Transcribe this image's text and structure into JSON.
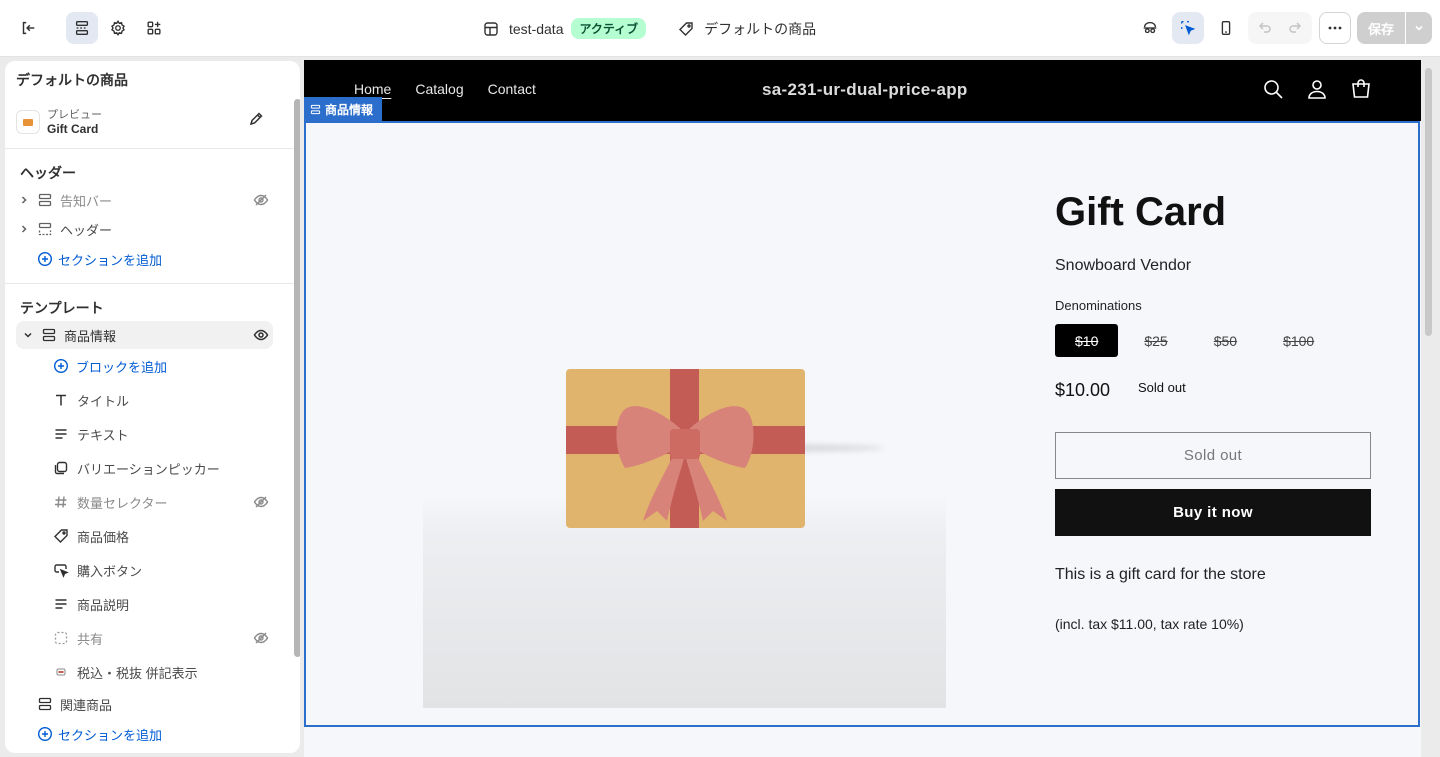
{
  "topbar": {
    "theme_name": "test-data",
    "theme_status": "アクティブ",
    "template_name": "デフォルトの商品",
    "save_label": "保存"
  },
  "sidebar": {
    "title": "デフォルトの商品",
    "preview": {
      "label": "プレビュー",
      "value": "Gift Card"
    },
    "header_group": {
      "heading": "ヘッダー",
      "items": [
        {
          "label": "告知バー",
          "hidden": true
        },
        {
          "label": "ヘッダー",
          "hidden": false
        }
      ],
      "add_section": "セクションを追加"
    },
    "template_group": {
      "heading": "テンプレート",
      "section": {
        "label": "商品情報"
      },
      "add_block": "ブロックを追加",
      "blocks": [
        {
          "label": "タイトル",
          "icon": "text-icon"
        },
        {
          "label": "テキスト",
          "icon": "align-left-icon"
        },
        {
          "label": "バリエーションピッカー",
          "icon": "variant-icon"
        },
        {
          "label": "数量セレクター",
          "icon": "hash-icon",
          "hidden": true
        },
        {
          "label": "商品価格",
          "icon": "price-tag-icon"
        },
        {
          "label": "購入ボタン",
          "icon": "cursor-button-icon"
        },
        {
          "label": "商品説明",
          "icon": "align-left-icon"
        },
        {
          "label": "共有",
          "icon": "share-frame-icon",
          "hidden": true
        },
        {
          "label": "税込・税抜 併記表示",
          "icon": "app-block-icon"
        }
      ],
      "related": "関連商品",
      "add_section": "セクションを追加"
    }
  },
  "store": {
    "nav": [
      "Home",
      "Catalog",
      "Contact"
    ],
    "name": "sa-231-ur-dual-price-app",
    "section_tag": "商品情報"
  },
  "product": {
    "title": "Gift Card",
    "vendor": "Snowboard Vendor",
    "denominations_label": "Denominations",
    "denominations": [
      "$10",
      "$25",
      "$50",
      "$100"
    ],
    "selected_denomination": "$10",
    "price": "$10.00",
    "sold_badge": "Sold out",
    "sold_button": "Sold out",
    "buy_button": "Buy it now",
    "description": "This is a gift card for the store",
    "tax_note": "(incl. tax $11.00, tax rate 10%)"
  },
  "colors": {
    "accent": "#2c6ecb",
    "active_badge_bg": "#b4fed2",
    "gift_box": "#e0b46c",
    "ribbon": "#c25c55"
  }
}
